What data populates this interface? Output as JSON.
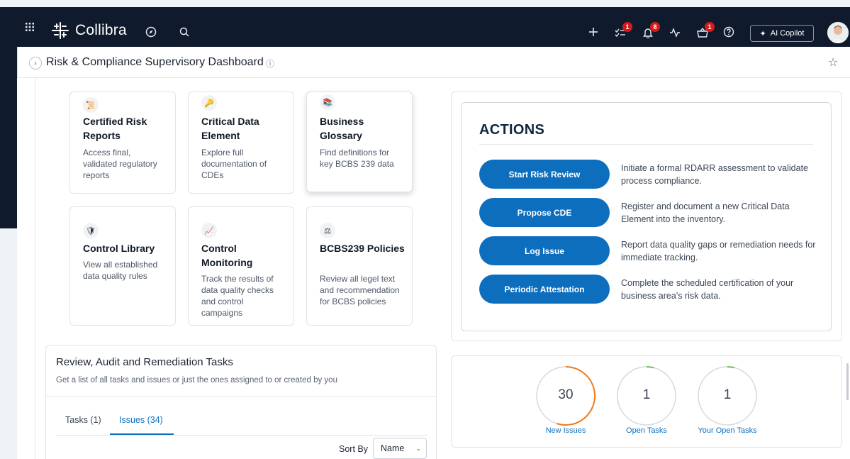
{
  "topbar": {
    "brand": "Collibra",
    "badges": {
      "tasks": "1",
      "notifications": "8",
      "basket": "1"
    },
    "copilot_label": "AI Copilot"
  },
  "page": {
    "title": "Risk & Compliance Supervisory Dashboard"
  },
  "cards": [
    {
      "title": "Certified Risk Reports",
      "desc": "Access final, validated regulatory reports",
      "icon": "scroll-icon"
    },
    {
      "title": "Critical Data Element",
      "desc": "Explore full documentation of CDEs",
      "icon": "key-icon"
    },
    {
      "title": "Business Glossary",
      "desc": "Find definitions for key BCBS 239 data",
      "icon": "books-icon"
    },
    {
      "title": "Control Library",
      "desc": "View all established data quality rules",
      "icon": "shield-icon"
    },
    {
      "title": "Control Monitoring",
      "desc": "Track the results of data quality checks and control campaigns",
      "icon": "chart-icon"
    },
    {
      "title": "BCBS239 Policies",
      "desc": "Review all legel text and recommendation for BCBS policies",
      "icon": "scales-icon"
    }
  ],
  "actions": {
    "title": "ACTIONS",
    "items": [
      {
        "label": "Start Risk Review",
        "desc": "Initiate a formal RDARR assessment to validate process compliance."
      },
      {
        "label": "Propose CDE",
        "desc": "Register and document a new Critical Data Element into the inventory."
      },
      {
        "label": "Log Issue",
        "desc": "Report data quality gaps or remediation needs for immediate tracking."
      },
      {
        "label": "Periodic Attestation",
        "desc": "Complete the scheduled certification of your business area's risk data."
      }
    ]
  },
  "tasks": {
    "title": "Review, Audit and Remediation Tasks",
    "subtitle": "Get a list of all tasks and issues or just the ones assigned to or created by you",
    "tabs": [
      "Tasks (1)",
      "Issues (34)"
    ],
    "sort_label": "Sort By",
    "sort_value": "Name"
  },
  "stats": [
    {
      "value": "30",
      "label": "New Issues",
      "fraction": 0.55,
      "color": "#f07a1a"
    },
    {
      "value": "1",
      "label": "Open Tasks",
      "fraction": 0.04,
      "color": "#6cc24a"
    },
    {
      "value": "1",
      "label": "Your Open Tasks",
      "fraction": 0.04,
      "color": "#6cc24a"
    }
  ]
}
